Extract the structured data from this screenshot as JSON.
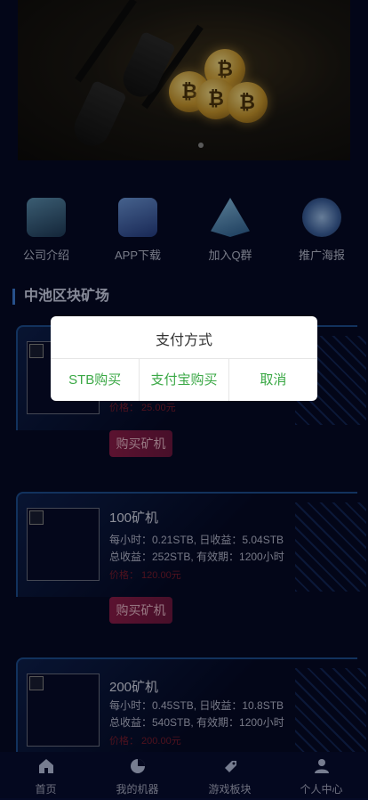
{
  "nav": [
    {
      "label": "公司介绍",
      "icon": "company-intro-icon",
      "color": "#3f6a86"
    },
    {
      "label": "APP下载",
      "icon": "app-download-icon",
      "color": "#3a5fa8"
    },
    {
      "label": "加入Q群",
      "icon": "join-qq-group-icon",
      "color": "#4f86b6"
    },
    {
      "label": "推广海报",
      "icon": "promotion-poster-icon",
      "color": "#5a7fb0"
    }
  ],
  "section": {
    "title": "中池区块矿场"
  },
  "miners": [
    {
      "name": "",
      "line1": "",
      "line2": "",
      "price": "价格：  25.00元",
      "buy_label": "购买矿机"
    },
    {
      "name": "100矿机",
      "line1": "每小时：0.21STB, 日收益：5.04STB",
      "line2": "总收益：252STB, 有效期：1200小时",
      "price": "价格：  120.00元",
      "buy_label": "购买矿机"
    },
    {
      "name": "200矿机",
      "line1": "每小时：0.45STB, 日收益：10.8STB",
      "line2": "总收益：540STB, 有效期：1200小时",
      "price": "价格：  200.00元",
      "buy_label": ""
    }
  ],
  "tabbar": [
    {
      "label": "首页",
      "icon": "home-icon"
    },
    {
      "label": "我的机器",
      "icon": "my-machines-icon"
    },
    {
      "label": "游戏板块",
      "icon": "game-section-icon"
    },
    {
      "label": "个人中心",
      "icon": "profile-icon"
    }
  ],
  "dialog": {
    "title": "支付方式",
    "options": [
      "STB购买",
      "支付宝购买",
      "取消"
    ],
    "accent": "#3aa845"
  }
}
